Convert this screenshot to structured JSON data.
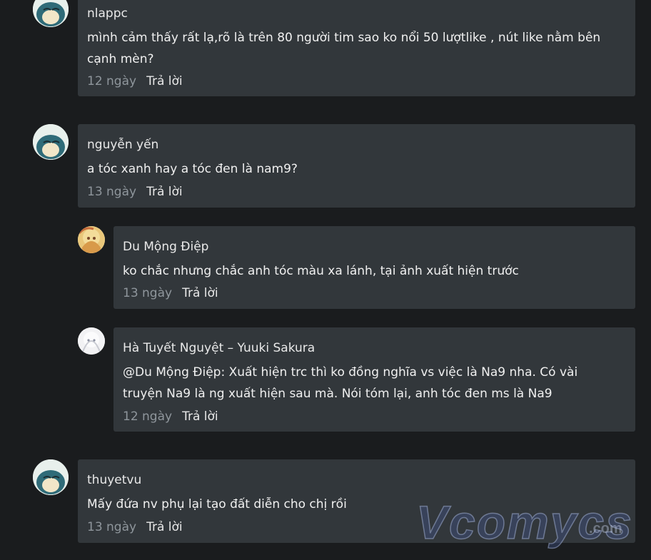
{
  "comments": [
    {
      "author": "nlappc",
      "text": "mình cảm thấy rất lạ,rõ là trên 80 người tim sao ko nổi 50 lượtlike , nút like nằm bên cạnh mèn?",
      "time": "12 ngày",
      "reply": "Trả lời"
    },
    {
      "author": "nguyễn yến",
      "text": "a tóc xanh hay a tóc đen là nam9?",
      "time": "13 ngày",
      "reply": "Trả lời",
      "replies": [
        {
          "author": "Du Mộng Điệp",
          "text": "ko chắc nhưng chắc anh tóc màu xa lánh, tại ảnh xuất hiện trước",
          "time": "13 ngày",
          "reply": "Trả lời"
        },
        {
          "author": "Hà Tuyết Nguyệt – Yuuki Sakura",
          "text": "@Du Mộng Điệp: Xuất hiện trc thì ko đồng nghĩa vs việc là Na9 nha. Có vài truyện Na9 là ng xuất hiện sau mà. Nói tóm lại, anh tóc đen ms là Na9",
          "time": "12 ngày",
          "reply": "Trả lời"
        }
      ]
    },
    {
      "author": "thuyetvu",
      "text": "Mấy đứa nv phụ lại tạo đất diễn cho chị rồi",
      "time": "13 ngày",
      "reply": "Trả lời"
    }
  ],
  "watermark": {
    "brand": "Vcomycs",
    "domain": ".com"
  },
  "colors": {
    "card": "#32373b",
    "background": "#1a1c1e",
    "muted": "#8f969c"
  }
}
